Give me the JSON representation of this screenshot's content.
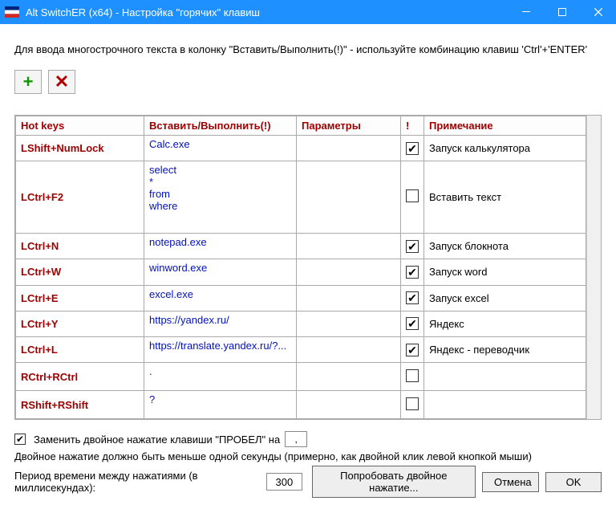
{
  "window": {
    "title": "Alt SwitchER (x64) - Настройка \"горячих\" клавиш"
  },
  "instructions": "Для ввода многострочного текста в колонку \"Вставить/Выполнить(!)\" - используйте комбинацию клавиш 'Ctrl'+'ENTER'",
  "columns": {
    "hotkeys": "Hot keys",
    "action": "Вставить/Выполнить(!)",
    "params": "Параметры",
    "flag": "!",
    "note": "Примечание"
  },
  "rows": [
    {
      "hotkey": "LShift+NumLock",
      "action": "Calc.exe",
      "params": "",
      "flag": true,
      "note": "Запуск калькулятора"
    },
    {
      "hotkey": "LCtrl+F2",
      "action": "select\n*\nfrom\nwhere",
      "params": "",
      "flag": false,
      "note": "Вставить текст"
    },
    {
      "hotkey": "LCtrl+N",
      "action": "notepad.exe",
      "params": "",
      "flag": true,
      "note": "Запуск блокнота"
    },
    {
      "hotkey": "LCtrl+W",
      "action": "winword.exe",
      "params": "",
      "flag": true,
      "note": "Запуск word"
    },
    {
      "hotkey": "LCtrl+E",
      "action": "excel.exe",
      "params": "",
      "flag": true,
      "note": "Запуск excel"
    },
    {
      "hotkey": "LCtrl+Y",
      "action": "https://yandex.ru/",
      "params": "",
      "flag": true,
      "note": "Яндекс"
    },
    {
      "hotkey": "LCtrl+L",
      "action": "https://translate.yandex.ru/?...",
      "params": "",
      "flag": true,
      "note": "Яндекс - переводчик"
    },
    {
      "hotkey": "RCtrl+RCtrl",
      "action": ".",
      "params": "",
      "flag": false,
      "note": ""
    },
    {
      "hotkey": "RShift+RShift",
      "action": "?",
      "params": "",
      "flag": false,
      "note": ""
    }
  ],
  "bottom": {
    "replace_checked": true,
    "replace_label": "Заменить двойное нажатие клавиши \"ПРОБЕЛ\" на",
    "replace_value": ",",
    "dbl_hint": "Двойное нажатие должно быть меньше одной секунды (примерно, как двойной клик левой кнопкой мыши)",
    "period_label": "Период времени между нажатиями (в миллисекундах):",
    "period_value": "300",
    "try_label": "Попробовать двойное нажатие...",
    "cancel_label": "Отмена",
    "ok_label": "OK"
  }
}
